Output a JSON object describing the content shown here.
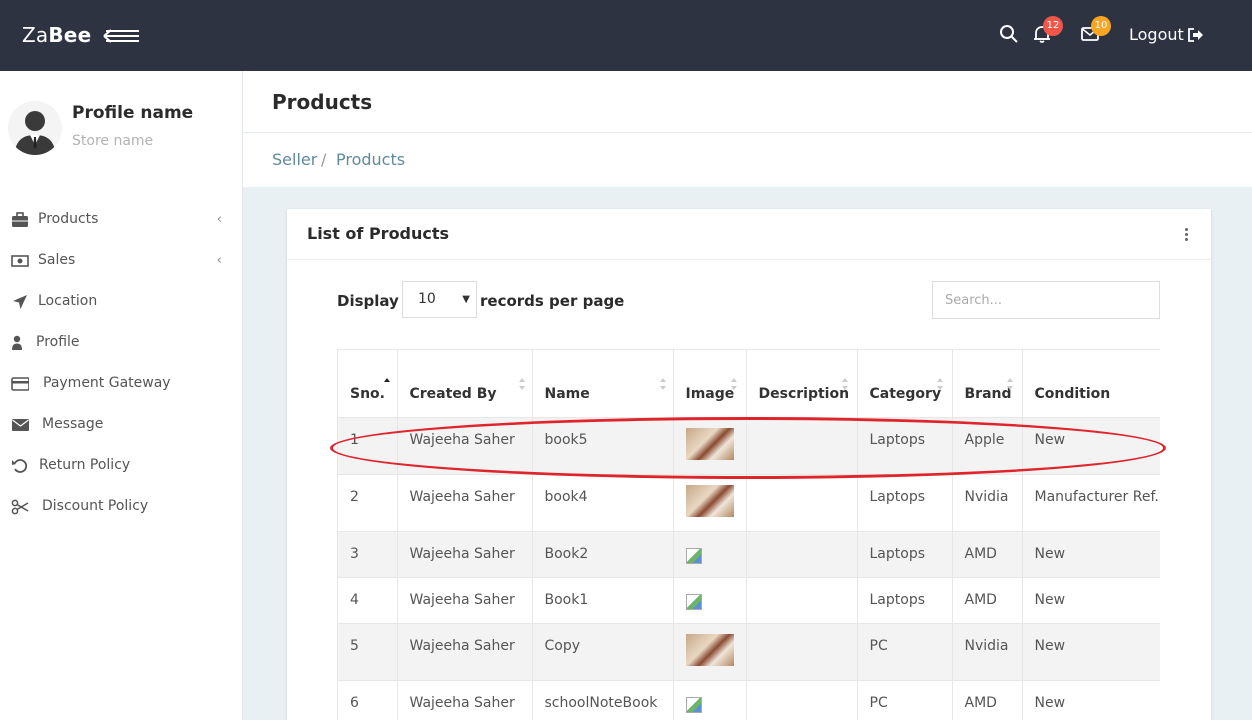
{
  "topbar": {
    "brand_light": "Za",
    "brand_bold": "Bee",
    "notifications_count": "12",
    "messages_count": "10",
    "logout_label": "Logout"
  },
  "sidebar": {
    "profile_name": "Profile name",
    "store_name": "Store name",
    "items": [
      {
        "label": "Products",
        "icon": "briefcase-icon",
        "has_children": true
      },
      {
        "label": "Sales",
        "icon": "money-icon",
        "has_children": true
      },
      {
        "label": "Location",
        "icon": "location-arrow-icon",
        "has_children": false
      },
      {
        "label": "Profile",
        "icon": "user-icon",
        "has_children": false
      },
      {
        "label": "Payment Gateway",
        "icon": "credit-card-icon",
        "has_children": false
      },
      {
        "label": "Message",
        "icon": "envelope-icon",
        "has_children": false
      },
      {
        "label": "Return Policy",
        "icon": "undo-icon",
        "has_children": false
      },
      {
        "label": "Discount Policy",
        "icon": "scissors-icon",
        "has_children": false
      }
    ]
  },
  "page": {
    "title": "Products",
    "breadcrumb": [
      "Seller",
      "Products"
    ]
  },
  "card": {
    "title": "List of Products",
    "display_label": "Display",
    "per_page_value": "10",
    "records_label": "records per page",
    "search_placeholder": "Search..."
  },
  "table": {
    "columns": [
      "Sno.",
      "Created By",
      "Name",
      "Image",
      "Description",
      "Category",
      "Brand",
      "Condition"
    ],
    "rows": [
      {
        "sno": "1",
        "created_by": "Wajeeha Saher",
        "name": "book5",
        "image": "thumb",
        "description": "",
        "category": "Laptops",
        "brand": "Apple",
        "condition": "New"
      },
      {
        "sno": "2",
        "created_by": "Wajeeha Saher",
        "name": "book4",
        "image": "thumb",
        "description": "",
        "category": "Laptops",
        "brand": "Nvidia",
        "condition": "Manufacturer Ref."
      },
      {
        "sno": "3",
        "created_by": "Wajeeha Saher",
        "name": "Book2",
        "image": "broken",
        "description": "",
        "category": "Laptops",
        "brand": "AMD",
        "condition": "New"
      },
      {
        "sno": "4",
        "created_by": "Wajeeha Saher",
        "name": "Book1",
        "image": "broken",
        "description": "",
        "category": "Laptops",
        "brand": "AMD",
        "condition": "New"
      },
      {
        "sno": "5",
        "created_by": "Wajeeha Saher",
        "name": "Copy",
        "image": "thumb",
        "description": "",
        "category": "PC",
        "brand": "Nvidia",
        "condition": "New"
      },
      {
        "sno": "6",
        "created_by": "Wajeeha Saher",
        "name": "schoolNoteBook",
        "image": "broken",
        "description": "",
        "category": "PC",
        "brand": "AMD",
        "condition": "New"
      }
    ]
  },
  "colors": {
    "topbar": "#2e3342",
    "badge_red": "#f0574a",
    "badge_orange": "#f6a623",
    "highlight": "#e0242b",
    "breadcrumb": "#5f8a9c"
  }
}
